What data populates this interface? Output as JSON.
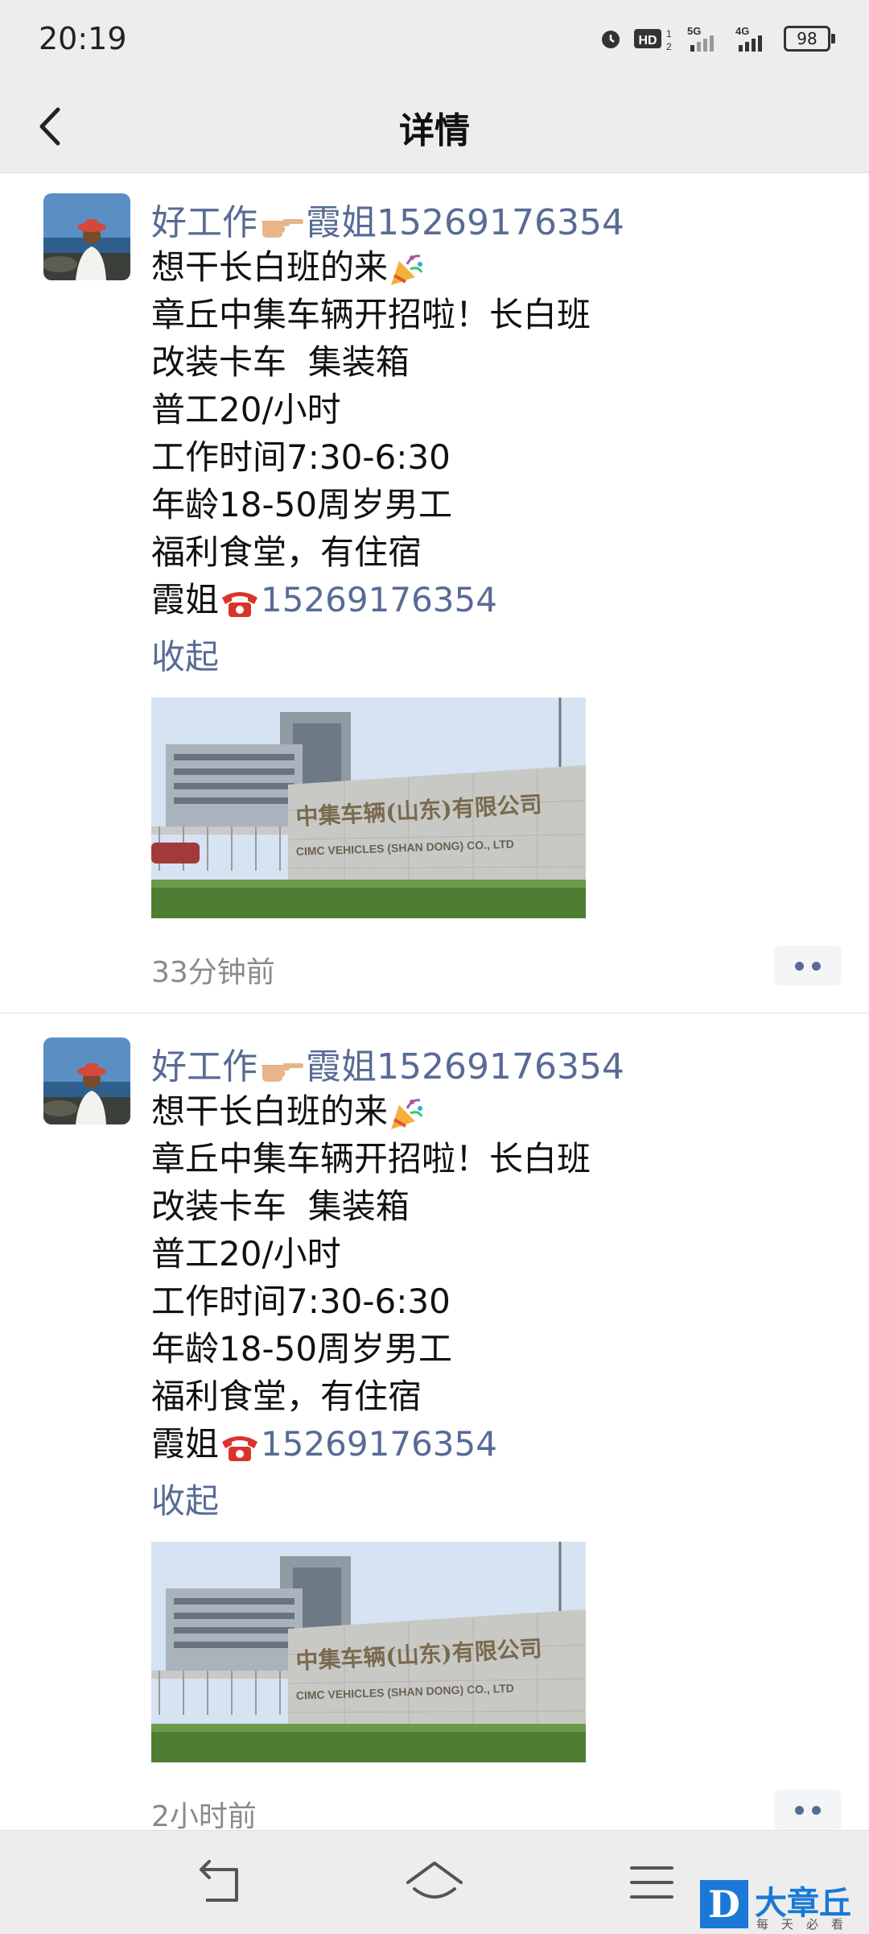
{
  "status_bar": {
    "time": "20:19",
    "icons": [
      "alarm-icon",
      "hd-icon",
      "5g-signal-icon",
      "4g-signal-icon",
      "battery-icon"
    ],
    "battery_level": "98"
  },
  "header": {
    "title": "详情",
    "back_icon": "chevron-left-icon"
  },
  "posts": [
    {
      "author": {
        "prefix": "好工作",
        "suffix": "霞姐15269176354"
      },
      "lines": [
        "想干长白班的来",
        "章丘中集车辆开招啦！长白班",
        "改装卡车  集装箱",
        "普工20/小时",
        "工作时间7:30-6:30",
        "年龄18-50周岁男工",
        "福利食堂，有住宿"
      ],
      "contact_name": "霞姐",
      "contact_phone": "15269176354",
      "collapse_label": "收起",
      "image_sign": {
        "cn": "中集车辆(山东)有限公司",
        "en": "CIMC VEHICLES (SHAN DONG) CO., LTD"
      },
      "time_ago": "33分钟前"
    },
    {
      "author": {
        "prefix": "好工作",
        "suffix": "霞姐15269176354"
      },
      "lines": [
        "想干长白班的来",
        "章丘中集车辆开招啦！长白班",
        "改装卡车  集装箱",
        "普工20/小时",
        "工作时间7:30-6:30",
        "年龄18-50周岁男工",
        "福利食堂，有住宿"
      ],
      "contact_name": "霞姐",
      "contact_phone": "15269176354",
      "collapse_label": "收起",
      "image_sign": {
        "cn": "中集车辆(山东)有限公司",
        "en": "CIMC VEHICLES (SHAN DONG) CO., LTD"
      },
      "time_ago": "2小时前"
    }
  ],
  "nav_bar": {
    "icons": [
      "back-nav-icon",
      "home-nav-icon",
      "menu-nav-icon"
    ]
  },
  "watermark": {
    "badge": "D",
    "text": "大章丘",
    "sub": "每天必看"
  },
  "colors": {
    "link": "#576b95",
    "bar_bg": "#ededed",
    "watermark": "#1a79d6"
  }
}
